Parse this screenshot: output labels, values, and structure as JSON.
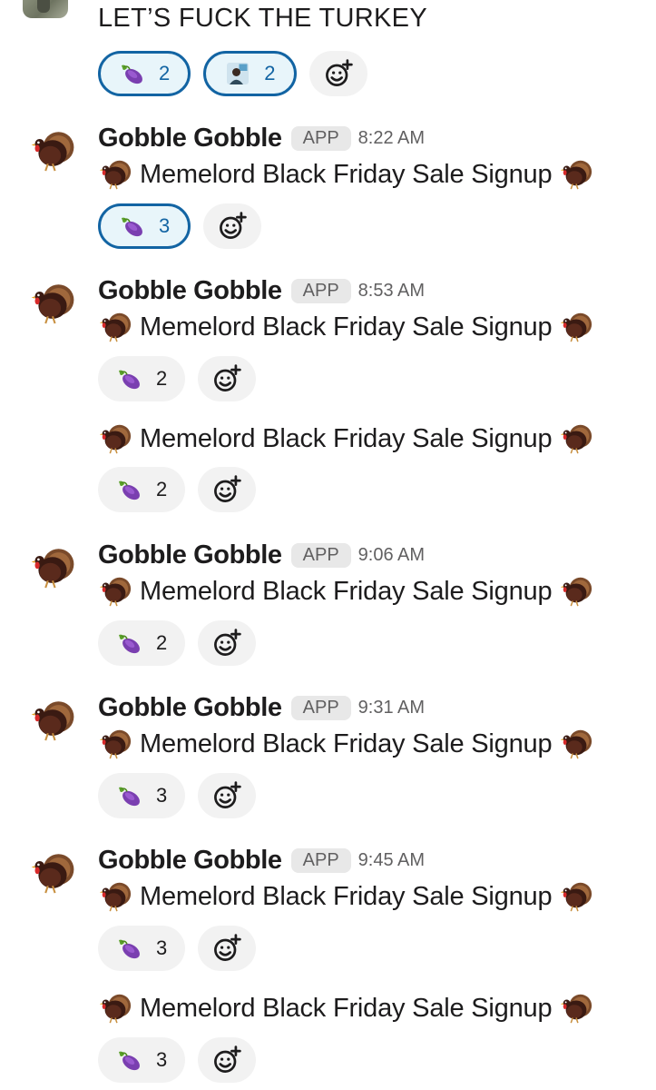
{
  "top_message": {
    "text": "LET’S FUCK THE TURKEY",
    "reactions": [
      {
        "emoji": "eggplant-icon",
        "count": "2",
        "selected": true
      },
      {
        "emoji": "user-avatar-emoji",
        "count": "2",
        "selected": true
      }
    ]
  },
  "groups": [
    {
      "sender": "Gobble Gobble",
      "badge": "APP",
      "time": "8:22 AM",
      "messages": [
        {
          "text": "Memelord Black Friday Sale Signup",
          "reaction": {
            "emoji": "eggplant-icon",
            "count": "3",
            "selected": true
          }
        }
      ]
    },
    {
      "sender": "Gobble Gobble",
      "badge": "APP",
      "time": "8:53 AM",
      "messages": [
        {
          "text": "Memelord Black Friday Sale Signup",
          "reaction": {
            "emoji": "eggplant-icon",
            "count": "2",
            "selected": false
          }
        },
        {
          "text": "Memelord Black Friday Sale Signup",
          "reaction": {
            "emoji": "eggplant-icon",
            "count": "2",
            "selected": false
          }
        }
      ]
    },
    {
      "sender": "Gobble Gobble",
      "badge": "APP",
      "time": "9:06 AM",
      "messages": [
        {
          "text": "Memelord Black Friday Sale Signup",
          "reaction": {
            "emoji": "eggplant-icon",
            "count": "2",
            "selected": false
          }
        }
      ]
    },
    {
      "sender": "Gobble Gobble",
      "badge": "APP",
      "time": "9:31 AM",
      "messages": [
        {
          "text": "Memelord Black Friday Sale Signup",
          "reaction": {
            "emoji": "eggplant-icon",
            "count": "3",
            "selected": false
          }
        }
      ]
    },
    {
      "sender": "Gobble Gobble",
      "badge": "APP",
      "time": "9:45 AM",
      "messages": [
        {
          "text": "Memelord Black Friday Sale Signup",
          "reaction": {
            "emoji": "eggplant-icon",
            "count": "3",
            "selected": false
          }
        },
        {
          "text": "Memelord Black Friday Sale Signup",
          "reaction": {
            "emoji": "eggplant-icon",
            "count": "3",
            "selected": false
          }
        }
      ]
    }
  ],
  "colors": {
    "accent": "#1264a3",
    "selected_bg": "#e8f5fa",
    "pill_bg": "#f2f2f2",
    "muted": "#616061"
  }
}
